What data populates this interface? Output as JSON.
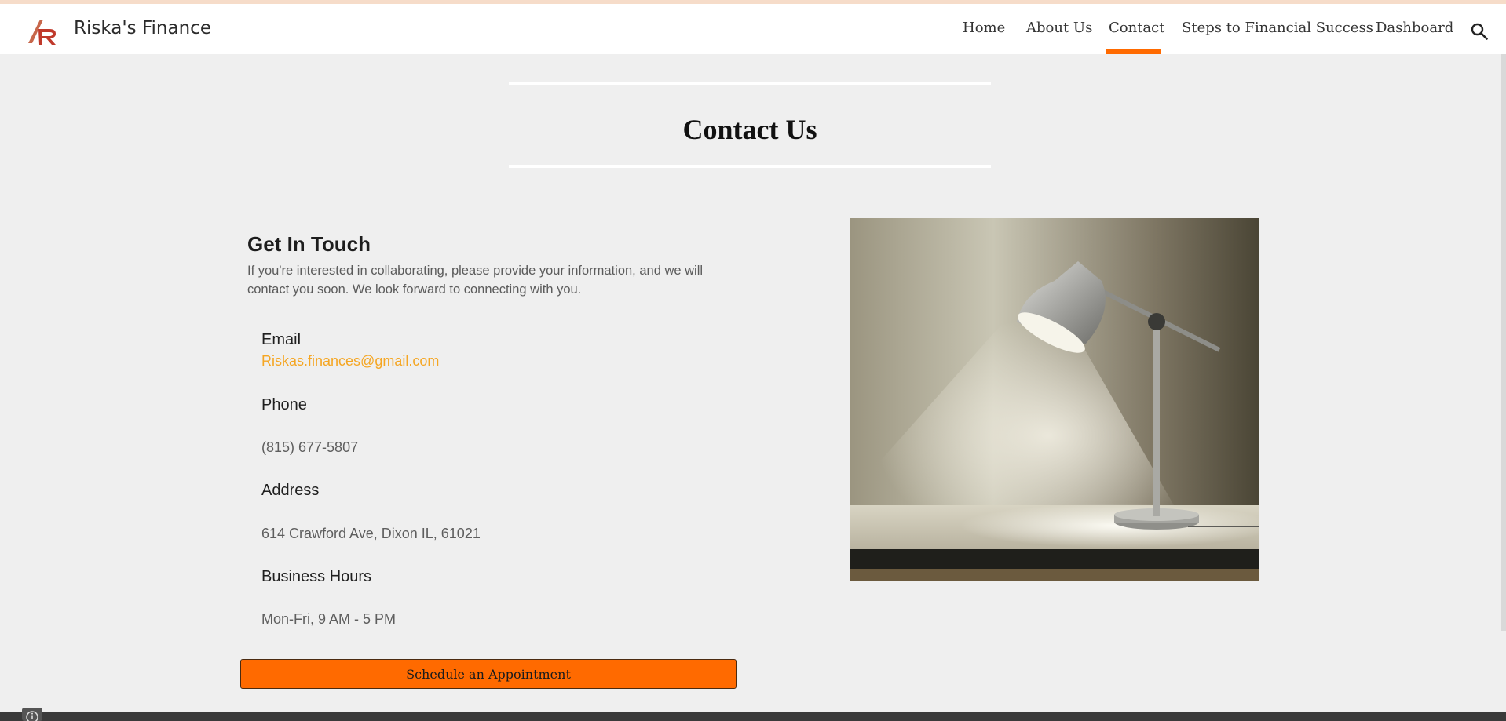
{
  "header": {
    "site_title": "Riska's Finance",
    "nav": [
      "Home",
      "About Us",
      "Contact",
      "Steps to Financial Success",
      "Dashboard"
    ],
    "active_nav": "Contact",
    "accent_color": "#ff6a00"
  },
  "main": {
    "page_title": "Contact Us",
    "get_in_touch_title": "Get In Touch",
    "intro": "If you're interested in collaborating, please provide your information, and we will contact you soon. We look forward to connecting with you.",
    "email_label": "Email",
    "email": "Riskas.finances@gmail.com",
    "phone_label": "Phone",
    "phone": "(815) 677-5807",
    "address_label": "Address",
    "address": "614 Crawford Ave, Dixon IL, 61021",
    "hours_label": "Business Hours",
    "hours": "Mon-Fri, 9 AM - 5 PM",
    "cta_label": "Schedule an Appointment"
  },
  "icons": {
    "logo": "riskas-finance-logo",
    "search": "search-icon",
    "info": "info-icon",
    "photo": "desk-lamp-photo"
  },
  "colors": {
    "page_bg": "#efefef",
    "email_link": "#f5a623",
    "button": "#ff6a00"
  }
}
